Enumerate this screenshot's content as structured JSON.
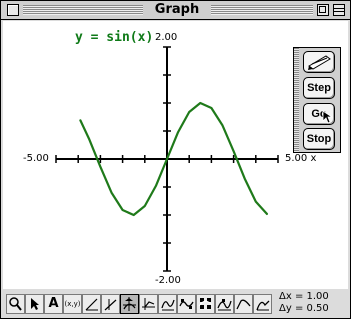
{
  "window": {
    "title": "Graph"
  },
  "plot": {
    "equation": "y = sin(x)",
    "y_max_label": "2.00",
    "y_min_label": "-2.00",
    "x_min_label": "-5.00",
    "x_max_label": "5.00 x",
    "curve_color": "#1f7a1a"
  },
  "chart_data": {
    "type": "line",
    "title": "y = sin(x)",
    "xlim": [
      -5,
      5
    ],
    "ylim": [
      -2,
      2
    ],
    "xlabel": "x",
    "ylabel": "",
    "grid": false,
    "series": [
      {
        "x": [
          -3.9,
          -3.5,
          -3.0,
          -2.5,
          -2.0,
          -1.5,
          -1.0,
          -0.5,
          0.0,
          0.5,
          1.0,
          1.5,
          2.0,
          2.5,
          3.0,
          3.5,
          4.0,
          4.5
        ],
        "values": [
          0.69,
          0.35,
          -0.14,
          -0.6,
          -0.91,
          -1.0,
          -0.84,
          -0.48,
          0.0,
          0.48,
          0.84,
          1.0,
          0.91,
          0.6,
          0.14,
          -0.35,
          -0.76,
          -0.98
        ]
      }
    ]
  },
  "palette": {
    "pencil_icon": "pencil-icon",
    "step_label": "Step",
    "go_label": "Go",
    "stop_label": "Stop"
  },
  "toolbar": {
    "tools": [
      "zoom-icon",
      "arrow-cursor-icon",
      "text-tool-icon",
      "coordinate-xy-icon",
      "line-tool-icon",
      "function-tool-icon",
      "trace-tool-icon",
      "step-function-icon",
      "wave-tool-icon",
      "derivative-tool-icon",
      "integral-tool-icon",
      "curve-tool-icon",
      "bezier-tool-icon"
    ],
    "text_label": "A",
    "xy_label": "(x,y)",
    "dx_label": "Δx = 1.00",
    "dy_label": "Δy = 0.50"
  }
}
